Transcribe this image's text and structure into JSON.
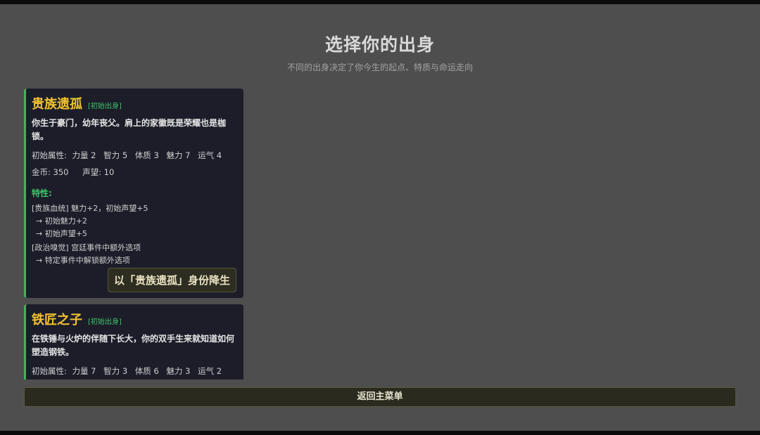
{
  "header": {
    "title": "选择你的出身",
    "subtitle": "不同的出身决定了你今生的起点、特质与命运走向"
  },
  "cards": [
    {
      "name": "贵族遗孤",
      "tag": "[初始出身]",
      "description": "你生于豪门，幼年丧父。肩上的家徽既是荣耀也是枷锁。",
      "attr_label": "初始属性:",
      "attributes": [
        "力量 2",
        "智力 5",
        "体质 3",
        "魅力 7",
        "运气 4"
      ],
      "gold": "金币: 350",
      "reputation": "声望: 10",
      "traits_label": "特性:",
      "traits": [
        {
          "title": "[贵族血统] 魅力+2，初始声望+5",
          "effects": [
            "→ 初始魅力+2",
            "→ 初始声望+5"
          ]
        },
        {
          "title": "[政治嗅觉] 宫廷事件中额外选项",
          "effects": [
            "→ 特定事件中解锁额外选项"
          ]
        }
      ],
      "select_label": "以「贵族遗孤」身份降生"
    },
    {
      "name": "铁匠之子",
      "tag": "[初始出身]",
      "description": "在铁锤与火炉的伴随下长大，你的双手生来就知道如何塑造钢铁。",
      "attr_label": "初始属性:",
      "attributes": [
        "力量 7",
        "智力 3",
        "体质 6",
        "魅力 3",
        "运气 2"
      ]
    }
  ],
  "footer": {
    "back_label": "返回主菜单"
  },
  "colors": {
    "background": "#4e4e4e",
    "card": "#1c1d29",
    "card_accent": "#3fb45a",
    "name": "#f2c231",
    "trait_label": "#3fc46a"
  }
}
